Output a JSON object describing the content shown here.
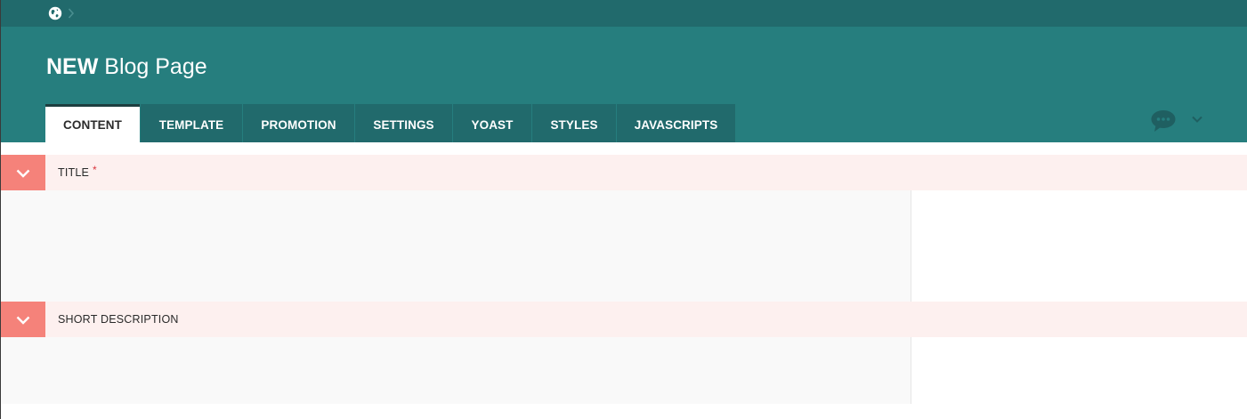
{
  "breadcrumb": {
    "home_icon": "globe-icon",
    "separator_icon": "chevron-right-icon"
  },
  "header": {
    "title_strong": "NEW",
    "title_rest": " Blog Page",
    "background": "#267e7e"
  },
  "tabs": [
    {
      "label": "CONTENT",
      "active": true
    },
    {
      "label": "TEMPLATE",
      "active": false
    },
    {
      "label": "PROMOTION",
      "active": false
    },
    {
      "label": "SETTINGS",
      "active": false
    },
    {
      "label": "YOAST",
      "active": false
    },
    {
      "label": "STYLES",
      "active": false
    },
    {
      "label": "JAVASCRIPTS",
      "active": false
    }
  ],
  "toolbar": {
    "comments_icon": "chat-bubble-icon",
    "dropdown_icon": "chevron-down-icon"
  },
  "sections": {
    "title": {
      "label": "TITLE",
      "required_marker": "*"
    },
    "short_description": {
      "label": "SHORT DESCRIPTION"
    }
  },
  "colors": {
    "topbar": "#216a6c",
    "tab_inactive": "#216a6c",
    "toggle": "#f5827a",
    "section_header": "#fdf0ef",
    "required": "#d9363e"
  }
}
